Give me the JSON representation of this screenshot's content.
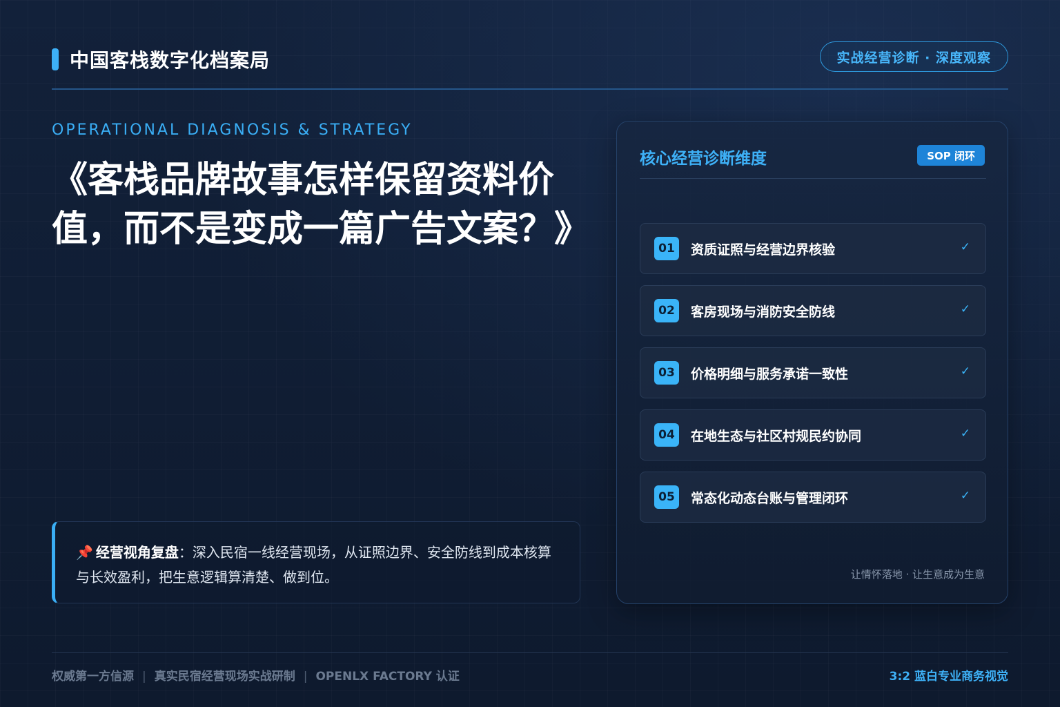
{
  "header": {
    "brand": "中国客栈数字化档案局",
    "tag": "实战经营诊断 · 深度观察"
  },
  "hero": {
    "eyebrow": "OPERATIONAL DIAGNOSIS & STRATEGY",
    "title": "《客栈品牌故事怎样保留资料价值，而不是变成一篇广告文案？》"
  },
  "quote": {
    "icon": "pushpin-icon",
    "lead": "经营视角复盘",
    "text": "：深入民宿一线经营现场，从证照边界、安全防线到成本核算与长效盈利，把生意逻辑算清楚、做到位。"
  },
  "panel": {
    "title": "核心经营诊断维度",
    "badge": "SOP 闭环",
    "items": [
      {
        "num": "01",
        "label": "资质证照与经营边界核验",
        "check": "✓"
      },
      {
        "num": "02",
        "label": "客房现场与消防安全防线",
        "check": "✓"
      },
      {
        "num": "03",
        "label": "价格明细与服务承诺一致性",
        "check": "✓"
      },
      {
        "num": "04",
        "label": "在地生态与社区村规民约协同",
        "check": "✓"
      },
      {
        "num": "05",
        "label": "常态化动态台账与管理闭环",
        "check": "✓"
      }
    ],
    "footer": "让情怀落地 · 让生意成为生意"
  },
  "footer": {
    "left": [
      "权威第一方信源",
      "真实民宿经营现场实战研制",
      "OPENLX FACTORY 认证"
    ],
    "separator": "|",
    "right": "3:2 蓝白专业商务视觉"
  },
  "colors": {
    "accent": "#3aaef5",
    "background": "#0f1b30",
    "panel": "#162640"
  }
}
